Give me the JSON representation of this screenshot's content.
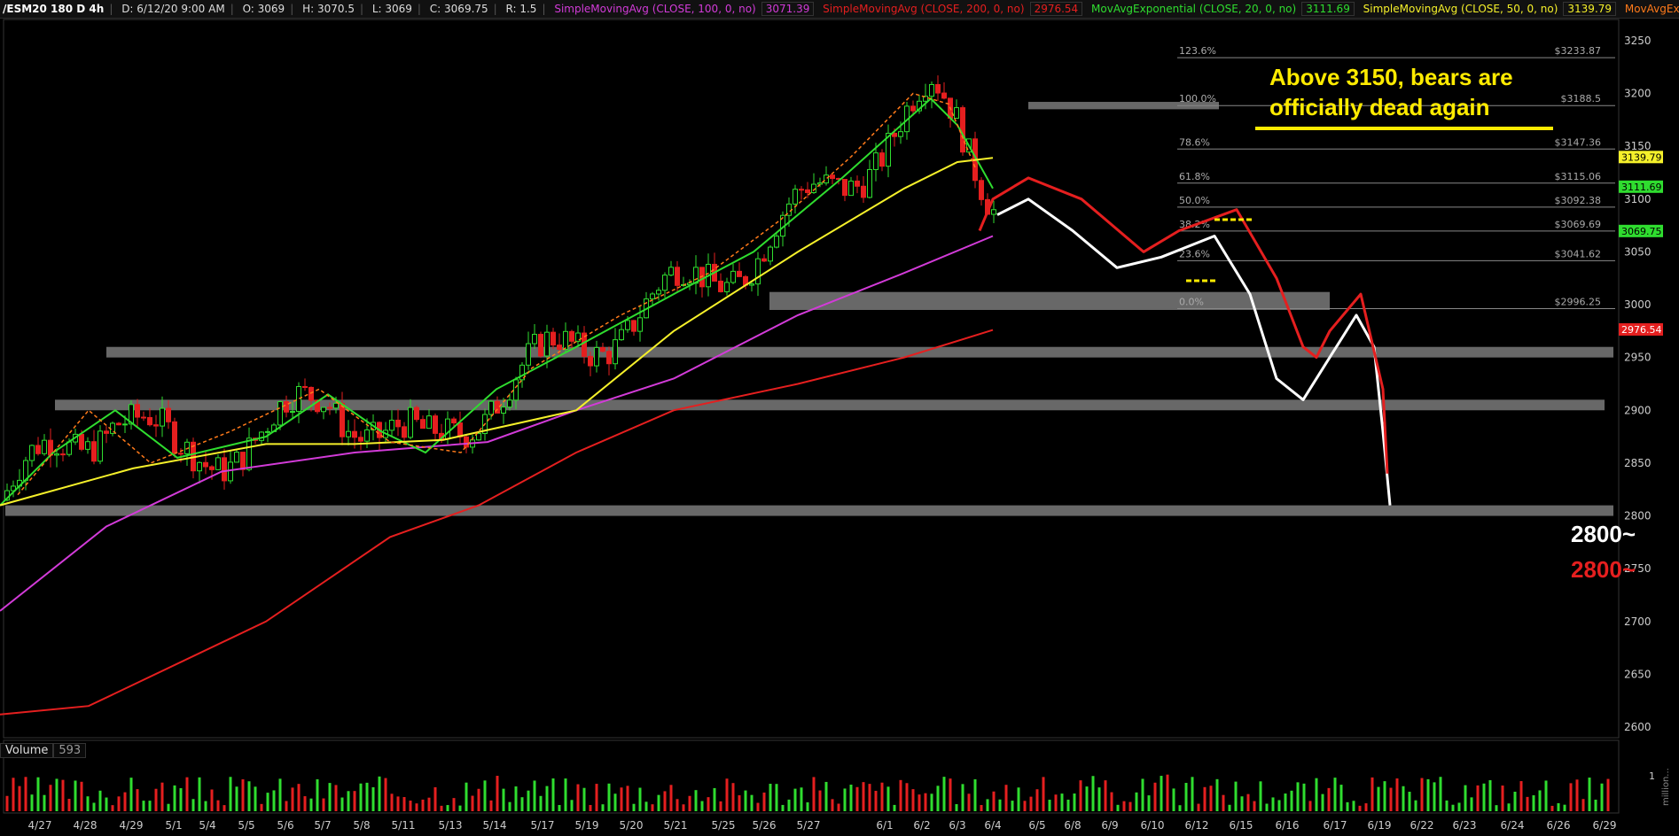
{
  "header": {
    "symbol": "/ESM20 180 D 4h",
    "date": "D: 6/12/20 9:00 AM",
    "open": "O: 3069",
    "high": "H: 3070.5",
    "low": "L: 3069",
    "close": "C: 3069.75",
    "range": "R: 1.5",
    "indicators": [
      {
        "label": "SimpleMovingAvg (CLOSE, 100, 0, no)",
        "value": "3071.39",
        "color": "#d23bd8"
      },
      {
        "label": "SimpleMovingAvg (CLOSE, 200, 0, no)",
        "value": "2976.54",
        "color": "#e51f1f"
      },
      {
        "label": "MovAvgExponential (CLOSE, 20, 0, no)",
        "value": "3111.69",
        "color": "#2fdd2f"
      },
      {
        "label": "SimpleMovingAvg (CLOSE, 50, 0, no)",
        "value": "3139.79",
        "color": "#f5f02a"
      },
      {
        "label": "MovAvgExponential (CLOSE...",
        "value": "",
        "color": "#ff7a1a"
      }
    ]
  },
  "annotation": {
    "line1": "Above 3150, bears are",
    "line2": "officially dead again",
    "target_white": "2800~",
    "target_red": "2800~"
  },
  "volume": {
    "label": "Volume",
    "value": "593",
    "axis_label": "1",
    "unit_label": "million..."
  },
  "chart_data": {
    "type": "candlestick",
    "y_ticks": [
      2600,
      2650,
      2700,
      2750,
      2800,
      2850,
      2900,
      2950,
      3000,
      3050,
      3100,
      3150,
      3200,
      3250
    ],
    "ylim": [
      2590,
      3270
    ],
    "x_labels": [
      "4/27",
      "4/28",
      "4/29",
      "5/1",
      "5/4",
      "5/5",
      "5/6",
      "5/7",
      "5/8",
      "5/11",
      "5/13",
      "5/14",
      "5/17",
      "5/19",
      "5/20",
      "5/21",
      "5/25",
      "5/26",
      "5/27",
      "6/1",
      "6/2",
      "6/3",
      "6/4",
      "6/5",
      "6/8",
      "6/9",
      "6/10",
      "6/12",
      "6/15",
      "6/16",
      "6/17",
      "6/19",
      "6/22",
      "6/23",
      "6/24",
      "6/26",
      "6/29"
    ],
    "series": [
      {
        "name": "SimpleMovingAvg (CLOSE, 100, 0, no)",
        "color": "#d23bd8",
        "points": [
          [
            0,
            2710
          ],
          [
            120,
            2790
          ],
          [
            250,
            2842
          ],
          [
            400,
            2860
          ],
          [
            550,
            2870
          ],
          [
            650,
            2900
          ],
          [
            760,
            2930
          ],
          [
            900,
            2990
          ],
          [
            1020,
            3030
          ],
          [
            1120,
            3065
          ]
        ]
      },
      {
        "name": "SimpleMovingAvg (CLOSE, 200, 0, no)",
        "color": "#e51f1f",
        "points": [
          [
            0,
            2612
          ],
          [
            100,
            2620
          ],
          [
            300,
            2700
          ],
          [
            440,
            2780
          ],
          [
            540,
            2810
          ],
          [
            650,
            2860
          ],
          [
            760,
            2900
          ],
          [
            900,
            2925
          ],
          [
            1020,
            2950
          ],
          [
            1120,
            2976
          ]
        ]
      },
      {
        "name": "MovAvgExponential (CLOSE, 20, 0, no)",
        "color": "#2fdd2f",
        "points": [
          [
            0,
            2810
          ],
          [
            60,
            2860
          ],
          [
            130,
            2900
          ],
          [
            200,
            2855
          ],
          [
            300,
            2875
          ],
          [
            370,
            2915
          ],
          [
            430,
            2880
          ],
          [
            480,
            2860
          ],
          [
            560,
            2920
          ],
          [
            650,
            2960
          ],
          [
            760,
            3010
          ],
          [
            850,
            3050
          ],
          [
            950,
            3120
          ],
          [
            1050,
            3195
          ],
          [
            1080,
            3170
          ],
          [
            1120,
            3110
          ]
        ]
      },
      {
        "name": "SimpleMovingAvg (CLOSE, 50, 0, no)",
        "color": "#f5f02a",
        "points": [
          [
            0,
            2810
          ],
          [
            150,
            2845
          ],
          [
            300,
            2868
          ],
          [
            400,
            2868
          ],
          [
            500,
            2872
          ],
          [
            650,
            2900
          ],
          [
            760,
            2975
          ],
          [
            900,
            3050
          ],
          [
            1020,
            3110
          ],
          [
            1080,
            3135
          ],
          [
            1120,
            3139
          ]
        ]
      }
    ],
    "fib_levels": [
      {
        "pct": "123.6%",
        "price": "$3233.87",
        "value": 3233.87
      },
      {
        "pct": "100.0%",
        "price": "$3188.5",
        "value": 3188.5
      },
      {
        "pct": "78.6%",
        "price": "$3147.36",
        "value": 3147.36
      },
      {
        "pct": "61.8%",
        "price": "$3115.06",
        "value": 3115.06
      },
      {
        "pct": "50.0%",
        "price": "$3092.38",
        "value": 3092.38
      },
      {
        "pct": "38.2%",
        "price": "$3069.69",
        "value": 3069.69
      },
      {
        "pct": "23.6%",
        "price": "$3041.62",
        "value": 3041.62
      },
      {
        "pct": "0.0%",
        "price": "$2996.25",
        "value": 2996.25
      }
    ],
    "zones": [
      {
        "low": 2800,
        "high": 2810
      },
      {
        "low": 2900,
        "high": 2910
      },
      {
        "low": 2950,
        "high": 2960
      },
      {
        "low": 2995,
        "high": 3012
      },
      {
        "low": 3185,
        "high": 3192
      }
    ],
    "price_tags": [
      {
        "text": "3139.79",
        "value": 3139.79,
        "bg": "#f5f02a",
        "fg": "#000"
      },
      {
        "text": "3111.69",
        "value": 3111.69,
        "bg": "#2fdd2f",
        "fg": "#000"
      },
      {
        "text": "3069.75",
        "value": 3069.75,
        "bg": "#2fdd2f",
        "fg": "#000"
      },
      {
        "text": "2976.54",
        "value": 2976.54,
        "bg": "#e51f1f",
        "fg": "#fff"
      }
    ],
    "white_projection": [
      [
        1125,
        3085
      ],
      [
        1160,
        3100
      ],
      [
        1210,
        3070
      ],
      [
        1260,
        3035
      ],
      [
        1310,
        3045
      ],
      [
        1370,
        3065
      ],
      [
        1410,
        3010
      ],
      [
        1440,
        2930
      ],
      [
        1470,
        2910
      ],
      [
        1500,
        2950
      ],
      [
        1530,
        2990
      ],
      [
        1550,
        2960
      ],
      [
        1560,
        2880
      ],
      [
        1568,
        2810
      ]
    ],
    "red_projection": [
      [
        1105,
        3070
      ],
      [
        1120,
        3100
      ],
      [
        1160,
        3120
      ],
      [
        1220,
        3100
      ],
      [
        1290,
        3050
      ],
      [
        1330,
        3070
      ],
      [
        1395,
        3090
      ],
      [
        1440,
        3025
      ],
      [
        1470,
        2960
      ],
      [
        1485,
        2950
      ],
      [
        1500,
        2975
      ],
      [
        1535,
        3010
      ],
      [
        1560,
        2920
      ],
      [
        1565,
        2840
      ]
    ]
  }
}
